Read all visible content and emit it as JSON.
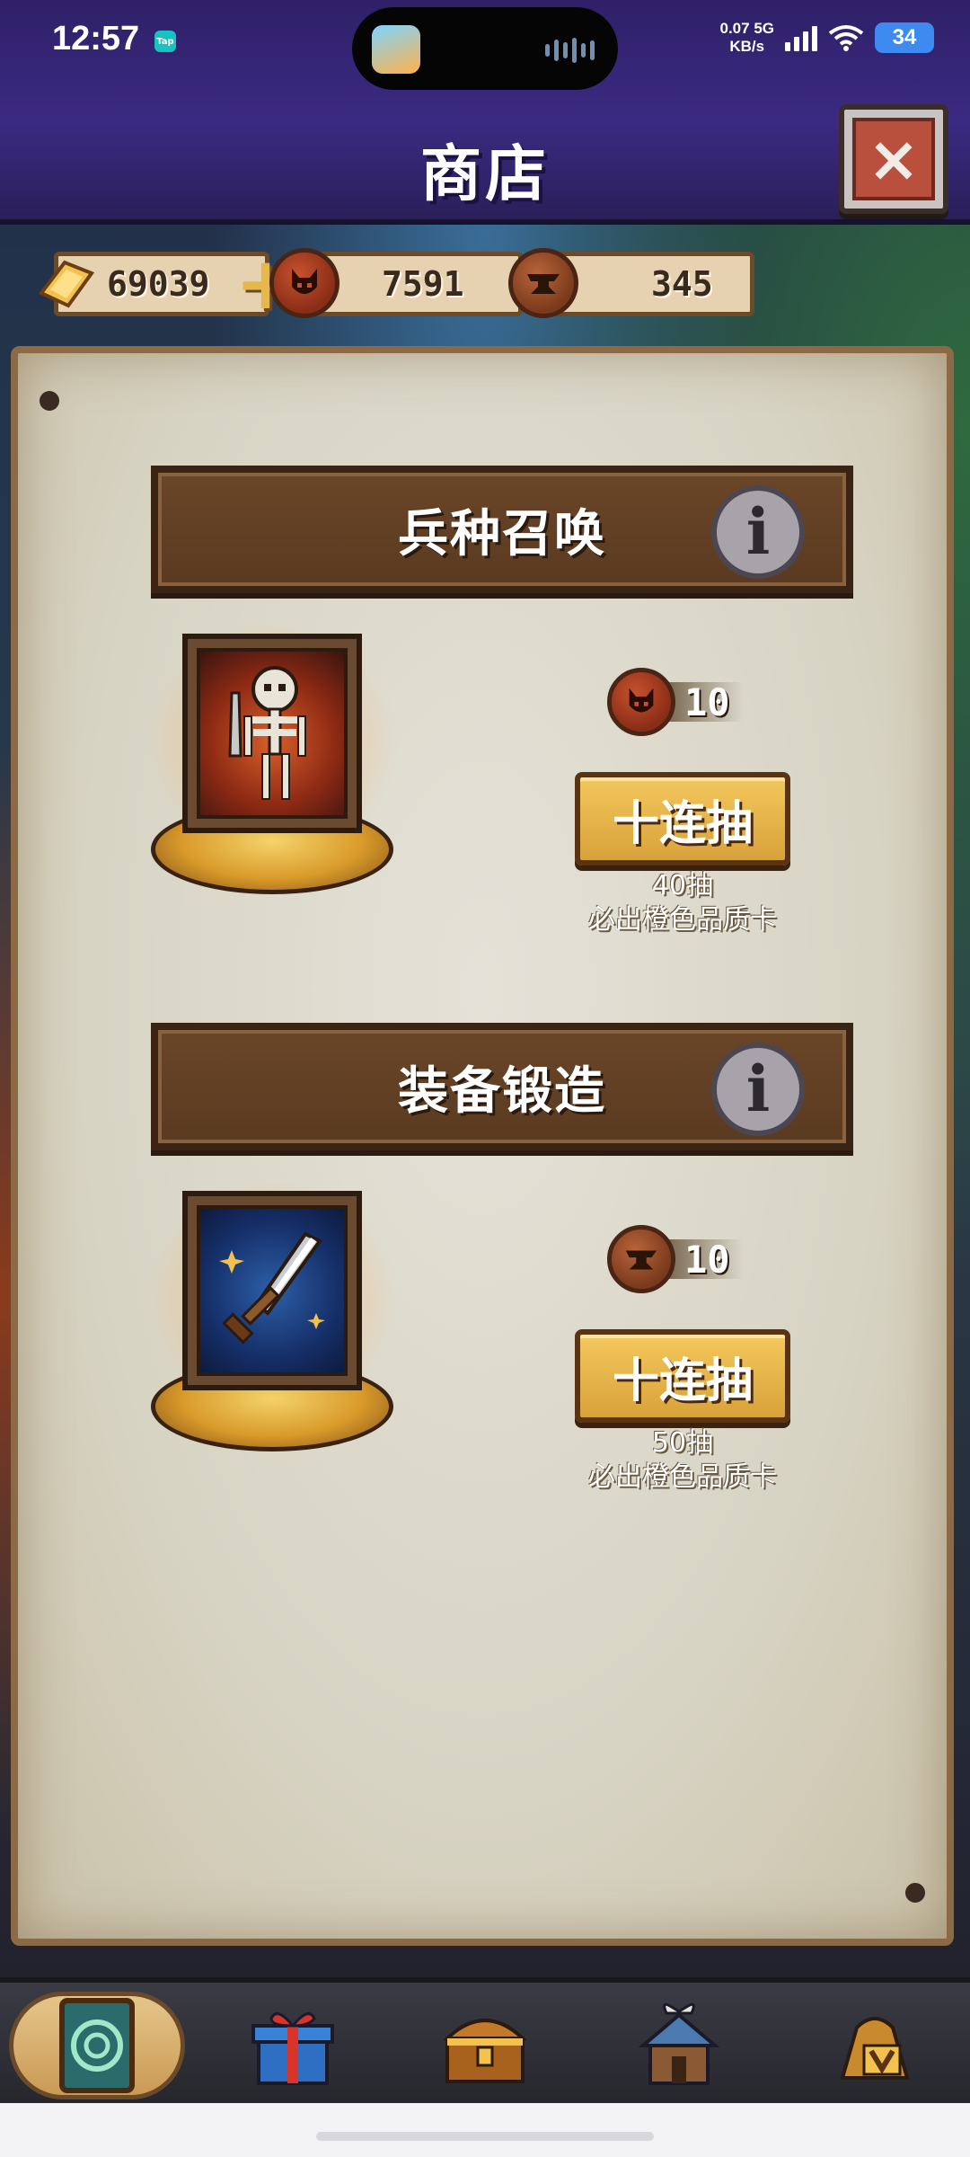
{
  "status_bar": {
    "time": "12:57",
    "tap_badge": "Tap",
    "net_speed_value": "0.07",
    "net_type": "5G",
    "net_unit": "KB/s",
    "battery": "34",
    "icons": [
      "signal-icon",
      "wifi-icon",
      "battery-icon"
    ]
  },
  "header": {
    "title": "商店",
    "close_icon": "close-icon"
  },
  "currencies": [
    {
      "name": "gold",
      "icon": "gold-bar-icon",
      "value": "69039"
    },
    {
      "name": "demon-token",
      "icon": "demon-coin-icon",
      "value": "7591"
    },
    {
      "name": "anvil-token",
      "icon": "anvil-coin-icon",
      "value": "345"
    }
  ],
  "sections": [
    {
      "title": "兵种召唤",
      "info_glyph": "i",
      "card_icon": "skeleton-warrior-icon",
      "cost_icon": "demon-coin-icon",
      "cost": "10",
      "button_label": "十连抽",
      "note_line1": "40抽",
      "note_line2": "必出橙色品质卡"
    },
    {
      "title": "装备锻造",
      "info_glyph": "i",
      "card_icon": "sword-icon",
      "cost_icon": "anvil-coin-icon",
      "cost": "10",
      "button_label": "十连抽",
      "note_line1": "50抽",
      "note_line2": "必出橙色品质卡"
    }
  ],
  "bottom_nav": [
    {
      "name": "cards",
      "icon": "card-deck-icon",
      "active": true
    },
    {
      "name": "gifts",
      "icon": "gift-box-icon",
      "active": false
    },
    {
      "name": "treasure",
      "icon": "treasure-chest-icon",
      "active": false
    },
    {
      "name": "base",
      "icon": "barracks-icon",
      "active": false
    },
    {
      "name": "vip",
      "icon": "vip-bag-icon",
      "active": false
    }
  ],
  "colors": {
    "header_bg": "#3b2a82",
    "parchment": "#d8d4c4",
    "banner": "#5a3a20",
    "button_gold": "#d8a23a"
  }
}
